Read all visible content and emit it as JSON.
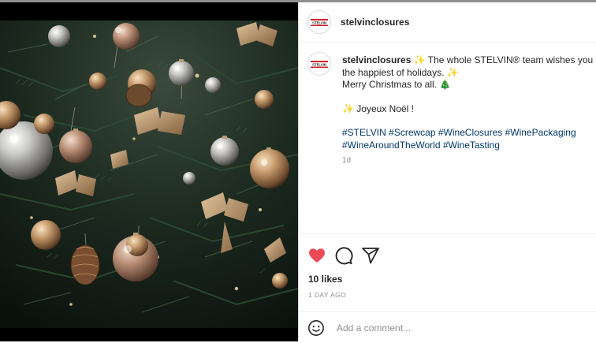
{
  "post": {
    "username": "stelvinclosures",
    "avatar_text": "STELVIN",
    "caption": {
      "line1": "The whole STELVIN® team wishes you the happiest of holidays.",
      "line2": "Merry Christmas to all.",
      "line3": "Joyeux Noël !",
      "hashtags": [
        "#STELVIN",
        "#Screwcap",
        "#WineClosures",
        "#WinePackaging",
        "#WineAroundTheWorld",
        "#WineTasting"
      ],
      "time": "1d"
    },
    "likes": "10 likes",
    "posted_ago": "1 DAY AGO",
    "comment_placeholder": "Add a comment...",
    "image_alt": "Christmas tree decorated with silver and gold baubles and bows"
  },
  "icons": {
    "like": "heart-icon-filled",
    "comment": "comment-bubble-icon",
    "share": "paper-plane-icon",
    "emoji": "smiley-icon",
    "sparkle": "sparkle-emoji",
    "tree": "christmas-tree-emoji"
  },
  "colors": {
    "like_red": "#ed4956",
    "hashtag_blue": "#00376b",
    "meta_grey": "#8e8e8e",
    "logo_red": "#d0202a"
  }
}
